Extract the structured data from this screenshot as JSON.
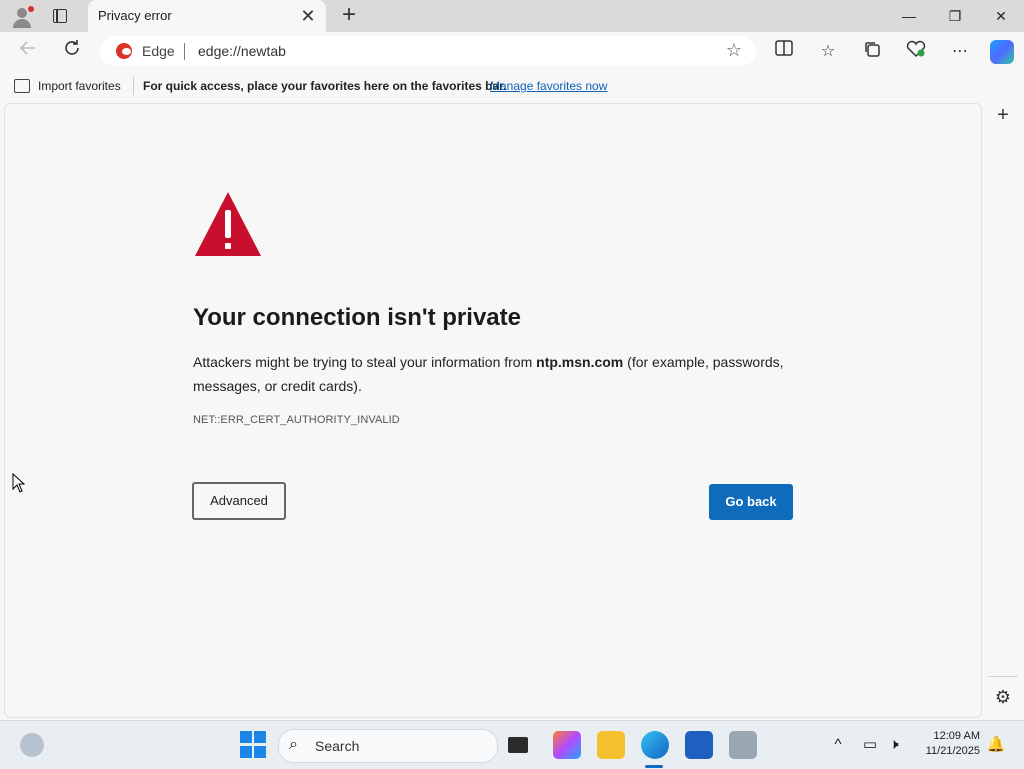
{
  "browser": {
    "tab_title": "Privacy error",
    "tab_close": "✕",
    "new_tab": "+",
    "window_controls": {
      "minimize": "—",
      "restore": "❐",
      "close": "✕"
    },
    "omnibox": {
      "site_label": "Edge",
      "url": "edge://newtab"
    },
    "favorites_bar": {
      "import_label": "Import favorites",
      "message": "For quick access, place your favorites here on the favorites bar.",
      "link": "Manage favorites now"
    }
  },
  "error_page": {
    "heading": "Your connection isn't private",
    "description_before": "Attackers might be trying to steal your information from ",
    "domain": "ntp.msn.com",
    "description_after": " (for example, passwords, messages, or credit cards).",
    "error_code": "NET::ERR_CERT_AUTHORITY_INVALID",
    "advanced_label": "Advanced",
    "go_back_label": "Go back"
  },
  "taskbar": {
    "search_placeholder": "Search",
    "time": "12:09 AM",
    "date": "11/21/2025"
  },
  "colors": {
    "warning_red": "#c8102e",
    "primary_blue": "#0f6cbd",
    "link_blue": "#0e62b8"
  }
}
